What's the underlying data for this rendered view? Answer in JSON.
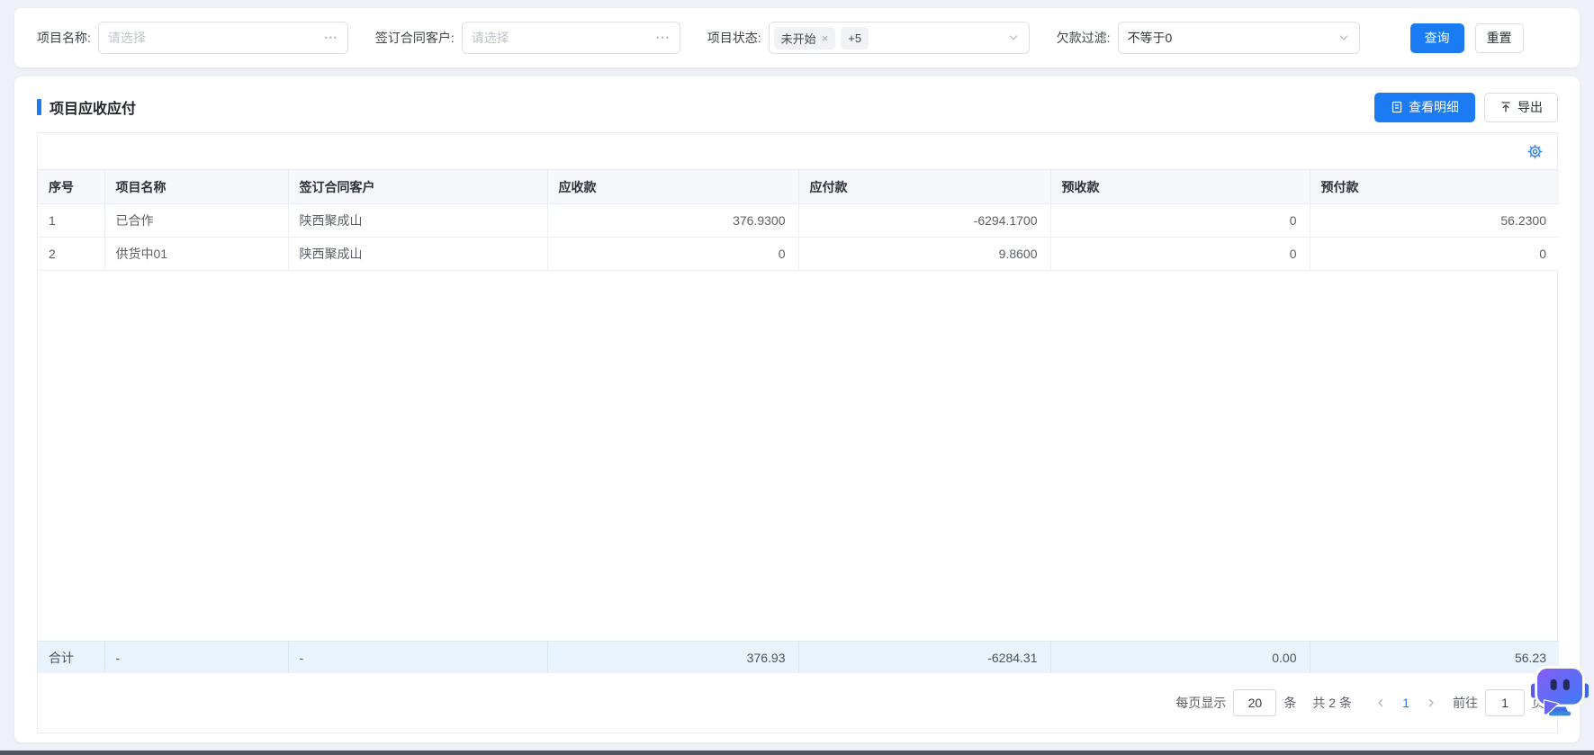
{
  "filter_bar": {
    "project_name_label": "项目名称:",
    "project_name_placeholder": "请选择",
    "ellipsis": "•••",
    "contract_customer_label": "签订合同客户:",
    "contract_customer_placeholder": "请选择",
    "project_status_label": "项目状态:",
    "status_tag_1": "未开始",
    "status_tag_1_close": "×",
    "status_tag_2": "+5",
    "debt_filter_label": "欠款过滤:",
    "debt_filter_value": "不等于0",
    "search_button": "查询",
    "reset_button": "重置"
  },
  "section": {
    "title": "项目应收应付",
    "view_detail_button": "查看明细",
    "export_button": "导出"
  },
  "table": {
    "columns": [
      "序号",
      "项目名称",
      "签订合同客户",
      "应收款",
      "应付款",
      "预收款",
      "预付款"
    ],
    "rows": [
      [
        "1",
        "已合作",
        "陕西聚成山",
        "376.9300",
        "-6294.1700",
        "0",
        "56.2300"
      ],
      [
        "2",
        "供货中01",
        "陕西聚成山",
        "0",
        "9.8600",
        "0",
        "0"
      ]
    ],
    "summary": [
      "合计",
      "-",
      "-",
      "376.93",
      "-6284.31",
      "0.00",
      "56.23"
    ]
  },
  "pagination": {
    "per_page_label": "每页显示",
    "per_page_value": "20",
    "per_page_unit": "条",
    "total_text": "共 2 条",
    "current_page": "1",
    "goto_label": "前往",
    "goto_page": "1",
    "page_unit": "页"
  },
  "icons": {
    "gear": "column-settings-gear",
    "view_detail": "document-lines",
    "export": "upload-arrow",
    "select_chevron": "chevron-down",
    "prev": "chevron-left",
    "next": "chevron-right",
    "assistant": "chat-robot"
  },
  "colors": {
    "primary": "#1b7bf3",
    "summary_row_bg": "#e8f3fe",
    "header_row_bg": "#f6f7fa",
    "tag_bg": "#f0f2f5",
    "page_bg": "#eef1f7"
  }
}
